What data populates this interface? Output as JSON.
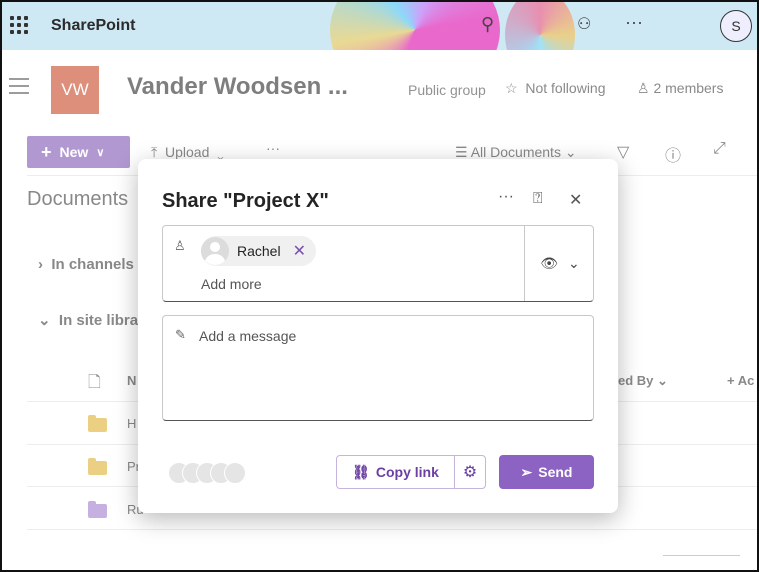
{
  "topbar": {
    "brand": "SharePoint",
    "avatar_initial": "S"
  },
  "site": {
    "logo": "VW",
    "title": "Vander Woodsen ...",
    "public_group": "Public group",
    "follow": "Not following",
    "members": "2 members"
  },
  "command_bar": {
    "new_label": "New",
    "upload_label": "Upload",
    "view_label": "All Documents"
  },
  "library": {
    "heading": "Documents",
    "groups": [
      "In channels",
      "In site libra"
    ],
    "columns": {
      "name": "N",
      "modified_by": "ed By",
      "add_column": "+ Ac"
    },
    "rows": [
      {
        "name": "H",
        "color": "#dcae2b"
      },
      {
        "name": "Pr",
        "color": "#dcae2b"
      },
      {
        "name": "Ru",
        "color": "#9b78cb"
      }
    ]
  },
  "dialog": {
    "title": "Share \"Project X\"",
    "recipient": "Rachel",
    "add_more_placeholder": "Add more",
    "message_placeholder": "Add a message",
    "copy_link_label": "Copy link",
    "send_label": "Send",
    "accent_color": "#7b4fb0"
  }
}
